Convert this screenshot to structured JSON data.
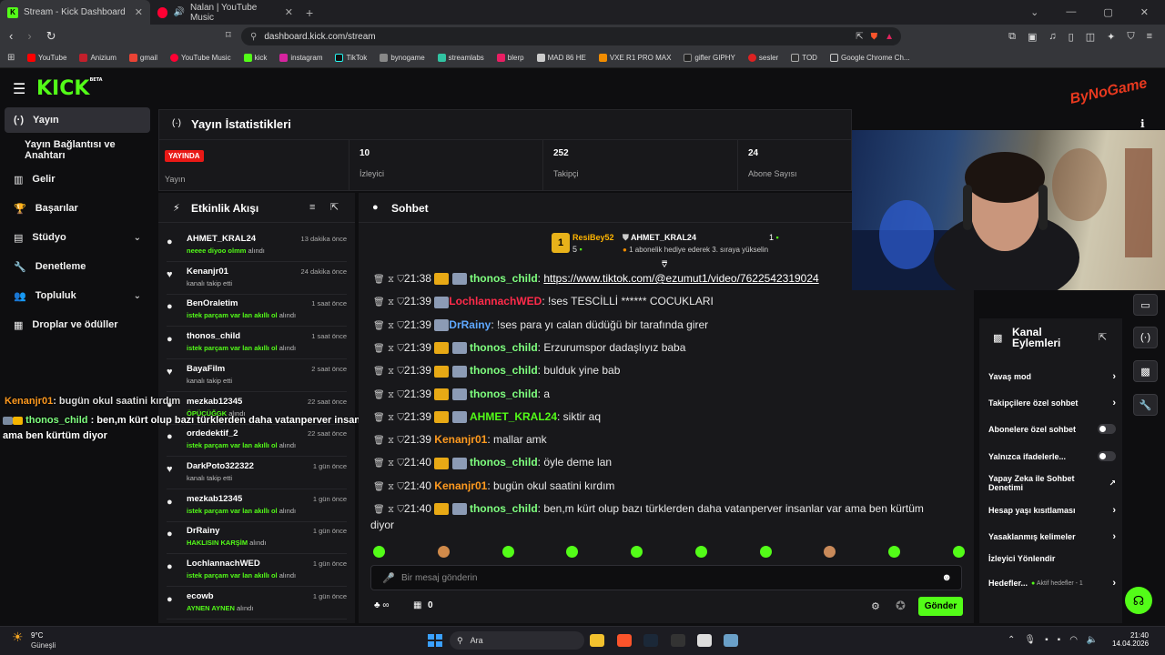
{
  "browser": {
    "tabs": [
      {
        "title": "Stream - Kick Dashboard",
        "active": true
      },
      {
        "title": "Nalan | YouTube Music",
        "active": false
      }
    ],
    "url": "dashboard.kick.com/stream",
    "bookmarks": [
      "YouTube",
      "Anizium",
      "gmail",
      "YouTube Music",
      "kick",
      "instagram",
      "TikTok",
      "bynogame",
      "streamlabs",
      "blerp",
      "MAD 86 HE",
      "VXE R1 PRO MAX",
      "gifler GIPHY",
      "sesler",
      "TOD",
      "Google Chrome Ch..."
    ]
  },
  "brand": {
    "logo": "KICK",
    "beta": "BETA",
    "accent": "#53fc18"
  },
  "nav": [
    {
      "label": "Yayın",
      "icon": "broadcast-icon",
      "active": true
    },
    {
      "label": "Yayın Bağlantısı ve Anahtarı",
      "icon": "",
      "active": false
    },
    {
      "label": "Gelir",
      "icon": "chart-icon",
      "active": false
    },
    {
      "label": "Başarılar",
      "icon": "trophy-icon",
      "active": false
    },
    {
      "label": "Stüdyo",
      "icon": "studio-icon",
      "active": false,
      "expandable": true
    },
    {
      "label": "Denetleme",
      "icon": "wrench-icon",
      "active": false
    },
    {
      "label": "Topluluk",
      "icon": "community-icon",
      "active": false,
      "expandable": true
    },
    {
      "label": "Droplar ve ödüller",
      "icon": "drops-icon",
      "active": false
    }
  ],
  "stats": {
    "title": "Yayın İstatistikleri",
    "live_badge": "YAYINDA",
    "live_label": "Yayın",
    "viewers": {
      "value": "10",
      "label": "İzleyici"
    },
    "followers": {
      "value": "252",
      "label": "Takipçi"
    },
    "subs": {
      "value": "24",
      "label": "Abone Sayısı"
    }
  },
  "activity": {
    "title": "Etkinlik Akışı",
    "items": [
      {
        "name": "AHMET_KRAL24",
        "highlight": "neeee diyoo olmm",
        "suffix": " alındı",
        "time": "13 dakika önce",
        "icon": "redeem-icon"
      },
      {
        "name": "Kenanjr01",
        "highlight": "",
        "suffix": "kanalı takip etti",
        "time": "24 dakika önce",
        "icon": "heart-icon"
      },
      {
        "name": "BenOraletim",
        "highlight": "istek parçam var lan akıllı ol",
        "suffix": " alındı",
        "time": "1 saat önce",
        "icon": "redeem-icon"
      },
      {
        "name": "thonos_child",
        "highlight": "istek parçam var lan akıllı ol",
        "suffix": " alındı",
        "time": "1 saat önce",
        "icon": "redeem-icon"
      },
      {
        "name": "BayaFilm",
        "highlight": "",
        "suffix": "kanalı takip etti",
        "time": "2 saat önce",
        "icon": "heart-icon"
      },
      {
        "name": "mezkab12345",
        "highlight": "ÖPÜCÜĞGK",
        "suffix": " alındı",
        "time": "22 saat önce",
        "icon": "redeem-icon"
      },
      {
        "name": "ordedektif_2",
        "highlight": "istek parçam var lan akıllı ol",
        "suffix": " alındı",
        "time": "22 saat önce",
        "icon": "redeem-icon"
      },
      {
        "name": "DarkPoto322322",
        "highlight": "",
        "suffix": "kanalı takip etti",
        "time": "1 gün önce",
        "icon": "heart-icon"
      },
      {
        "name": "mezkab12345",
        "highlight": "istek parçam var lan akıllı ol",
        "suffix": " alındı",
        "time": "1 gün önce",
        "icon": "redeem-icon"
      },
      {
        "name": "DrRainy",
        "highlight": "HAKLISIN KARŞİM",
        "suffix": " alındı",
        "time": "1 gün önce",
        "icon": "redeem-icon"
      },
      {
        "name": "LochlannachWED",
        "highlight": "istek parçam var lan akıllı ol",
        "suffix": " alındı",
        "time": "1 gün önce",
        "icon": "redeem-icon"
      },
      {
        "name": "ecowb",
        "highlight": "AYNEN AYNEN",
        "suffix": " alındı",
        "time": "1 gün önce",
        "icon": "redeem-icon"
      }
    ]
  },
  "chat": {
    "title": "Sohbet",
    "pinned": {
      "rank": "1",
      "user": "ResiBey52",
      "count": "5",
      "gift_user": "AHMET_KRAL24",
      "gift_count": "1",
      "gift_text": "1 abonelik hediye ederek 3. sıraya yükselin"
    },
    "messages": [
      {
        "time": "21:38",
        "user": "thonos_child",
        "color": "#7fff7f",
        "text": "https://www.tiktok.com/@ezumut1/video/7622542319024",
        "link": true
      },
      {
        "time": "21:39",
        "user": "LochlannachWED",
        "color": "#ff2b4a",
        "text": "!ses TESCİLLİ ****** COCUKLARI"
      },
      {
        "time": "21:39",
        "user": "DrRainy",
        "color": "#5fa8ff",
        "text": "!ses para yı calan düdüğü bir tarafında girer"
      },
      {
        "time": "21:39",
        "user": "thonos_child",
        "color": "#7fff7f",
        "text": "Erzurumspor dadaşlıyız baba"
      },
      {
        "time": "21:39",
        "user": "thonos_child",
        "color": "#7fff7f",
        "text": "bulduk yine bab"
      },
      {
        "time": "21:39",
        "user": "thonos_child",
        "color": "#7fff7f",
        "text": "a"
      },
      {
        "time": "21:39",
        "user": "AHMET_KRAL24",
        "color": "#53fc18",
        "text": "siktir aq"
      },
      {
        "time": "21:39",
        "user": "Kenanjr01",
        "color": "#ff9a1f",
        "text": "mallar amk"
      },
      {
        "time": "21:40",
        "user": "thonos_child",
        "color": "#7fff7f",
        "text": "öyle deme lan"
      },
      {
        "time": "21:40",
        "user": "Kenanjr01",
        "color": "#ff9a1f",
        "text": "bugün okul saatini kırdım"
      },
      {
        "time": "21:40",
        "user": "thonos_child",
        "color": "#7fff7f",
        "text": "ben,m kürt olup bazı türklerden daha vatanperver insanlar var ama ben kürtüm",
        "cont": "diyor"
      }
    ],
    "input_placeholder": "Bir mesaj gönderin",
    "points": "0",
    "send_label": "Gönder"
  },
  "overlay": {
    "line1_user": "Kenanjr01",
    "line1_text": ": bugün okul saatini kırdım",
    "line2_user": "thonos_child",
    "line2_text": " : ben,m kürt olup bazı türklerden daha vatanperver insanlar var",
    "line3_text": "ama ben kürtüm diyor",
    "watermark": "ByNoGame"
  },
  "actions": {
    "title": "Kanal Eylemleri",
    "items": [
      {
        "label": "Yavaş mod",
        "type": "arrow"
      },
      {
        "label": "Takipçilere özel sohbet",
        "type": "arrow"
      },
      {
        "label": "Abonelere özel sohbet",
        "type": "toggle"
      },
      {
        "label": "Yalnızca ifadelerle...",
        "type": "toggle"
      },
      {
        "label": "Yapay Zeka ile Sohbet Denetimi",
        "type": "external"
      },
      {
        "label": "Hesap yaşı kısıtlaması",
        "type": "arrow"
      },
      {
        "label": "Yasaklanmış kelimeler",
        "type": "arrow"
      },
      {
        "label": "İzleyici Yönlendir",
        "type": "none"
      },
      {
        "label": "Hedefler...",
        "type": "arrow",
        "extra": "Aktif hedefler - 1"
      }
    ]
  },
  "taskbar": {
    "weather_temp": "9°C",
    "weather_desc": "Güneşli",
    "search": "Ara",
    "time": "21:40",
    "date": "14.04.2026"
  }
}
